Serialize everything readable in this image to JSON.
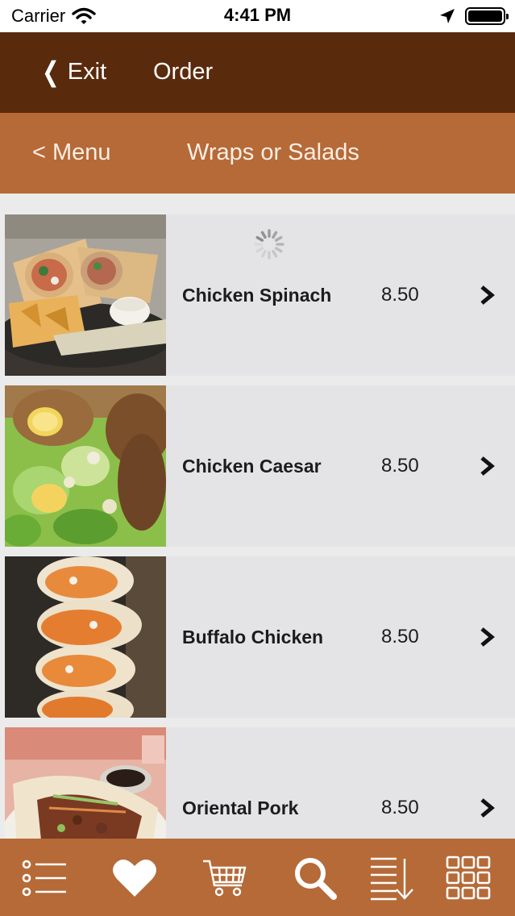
{
  "status": {
    "carrier": "Carrier",
    "time": "4:41 PM"
  },
  "header": {
    "exit_label": "Exit",
    "title": "Order"
  },
  "subheader": {
    "back_label": "< Menu",
    "title": "Wraps or Salads"
  },
  "items": [
    {
      "name": "Chicken Spinach",
      "price": "8.50"
    },
    {
      "name": "Chicken Caesar",
      "price": "8.50"
    },
    {
      "name": "Buffalo Chicken",
      "price": "8.50"
    },
    {
      "name": "Oriental Pork",
      "price": "8.50"
    }
  ],
  "tabs": [
    "list-icon",
    "heart-icon",
    "cart-icon",
    "search-icon",
    "sort-icon",
    "grid-icon"
  ],
  "colors": {
    "header": "#5a2a0d",
    "subheader": "#b56a38",
    "tabbar": "#b56a38"
  }
}
